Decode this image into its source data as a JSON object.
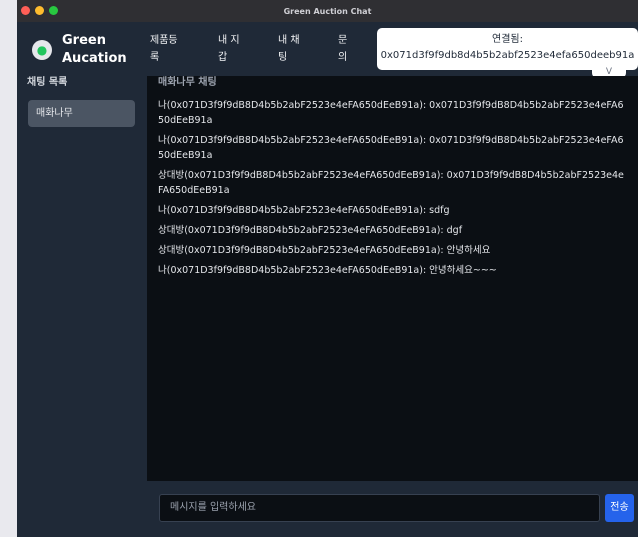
{
  "window": {
    "title": "Green Auction Chat",
    "lights": [
      "#ff5f57",
      "#febc2e",
      "#28c840"
    ]
  },
  "navbar": {
    "brand": "Green Aucation",
    "links": [
      "제품등록",
      "내 지갑",
      "내 채팅",
      "문의"
    ],
    "wallet_label": "연결됨:",
    "wallet_address": "0x071d3f9f9db8d4b5b2abf2523e4efa650deeb91a",
    "wallet_chevron": "V"
  },
  "sidebar": {
    "title": "채팅 목록",
    "rooms": [
      "매화나무"
    ]
  },
  "chat": {
    "header": "매화나무 채팅",
    "messages": [
      "나(0x071D3f9f9dB8D4b5b2abF2523e4eFA650dEeB91a): 0x071D3f9f9dB8D4b5b2abF2523e4eFA650dEeB91a",
      "나(0x071D3f9f9dB8D4b5b2abF2523e4eFA650dEeB91a): 0x071D3f9f9dB8D4b5b2abF2523e4eFA650dEeB91a",
      "상대방(0x071D3f9f9dB8D4b5b2abF2523e4eFA650dEeB91a): 0x071D3f9f9dB8D4b5b2abF2523e4eFA650dEeB91a",
      "나(0x071D3f9f9dB8D4b5b2abF2523e4eFA650dEeB91a): sdfg",
      "상대방(0x071D3f9f9dB8D4b5b2abF2523e4eFA650dEeB91a): dgf",
      "상대방(0x071D3f9f9dB8D4b5b2abF2523e4eFA650dEeB91a): 안녕하세요",
      "나(0x071D3f9f9dB8D4b5b2abF2523e4eFA650dEeB91a): 안녕하세요~~~"
    ]
  },
  "composer": {
    "placeholder": "메시지를 입력하세요",
    "send_label": "전송"
  },
  "colors": {
    "nav_bg": "#1f2937",
    "chat_bg": "#0b0f14",
    "accent": "#2563eb",
    "logo_green": "#22c55e"
  },
  "icons": {
    "logo": "leaf-icon"
  }
}
